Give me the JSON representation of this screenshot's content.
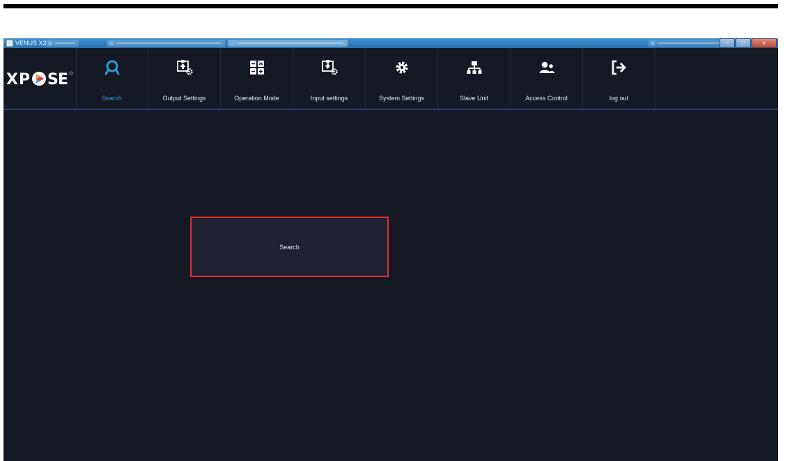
{
  "window": {
    "title": "VENUS X2",
    "minimize_glyph": "–",
    "maximize_glyph": "□",
    "close_glyph": "x"
  },
  "logo": {
    "text": "XPOSE"
  },
  "nav": [
    {
      "label": "Search",
      "icon": "search-icon",
      "active": true
    },
    {
      "label": "Output Settings",
      "icon": "output-settings-icon",
      "active": false
    },
    {
      "label": "Operation Mode",
      "icon": "operation-mode-icon",
      "active": false
    },
    {
      "label": "Input settings",
      "icon": "input-settings-icon",
      "active": false
    },
    {
      "label": "System Settings",
      "icon": "gear-icon",
      "active": false
    },
    {
      "label": "Slave Unit",
      "icon": "network-icon",
      "active": false
    },
    {
      "label": "Access Control",
      "icon": "users-icon",
      "active": false
    },
    {
      "label": "log out",
      "icon": "logout-icon",
      "active": false
    }
  ],
  "main": {
    "search_button_label": "Search"
  },
  "colors": {
    "background": "#151923",
    "accent": "#2d9ce0",
    "highlight_border": "#e03131",
    "panel": "#202232"
  }
}
